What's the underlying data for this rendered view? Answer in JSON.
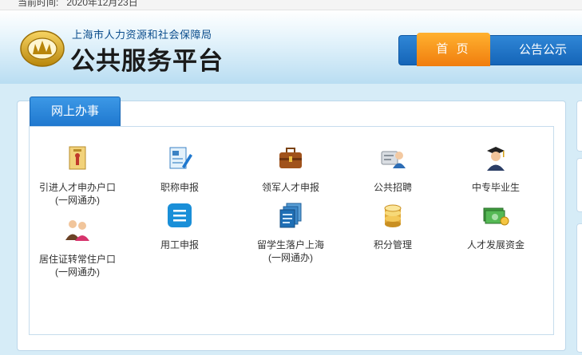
{
  "topbar": {
    "date_text": "当前时间:   2020年12月23日"
  },
  "header": {
    "org_name": "上海市人力资源和社会保障局",
    "platform_name": "公共服务平台",
    "logo_icon": "shanghai-emblem-icon"
  },
  "nav": {
    "home": "首 页",
    "notice": "公告公示"
  },
  "colors": {
    "accent_orange": "#f39214",
    "brand_blue": "#1f78cf",
    "background": "#d6ecf7"
  },
  "panel": {
    "tab_label": "网上办事",
    "services": [
      {
        "label": "引进人才申办户口",
        "sub": "(一网通办)",
        "icon": "document-envelope-icon"
      },
      {
        "label": "职称申报",
        "sub": "",
        "icon": "certificate-pen-icon"
      },
      {
        "label": "领军人才申报",
        "sub": "",
        "icon": "briefcase-icon"
      },
      {
        "label": "公共招聘",
        "sub": "",
        "icon": "recruitment-card-icon"
      },
      {
        "label": "中专毕业生",
        "sub": "",
        "icon": "graduate-icon"
      },
      {
        "label": "居住证转常住户口",
        "sub": "(一网通办)",
        "icon": "people-icon"
      },
      {
        "label": "用工申报",
        "sub": "",
        "icon": "list-icon"
      },
      {
        "label": "留学生落户上海",
        "sub": "(一网通办)",
        "icon": "stacked-documents-icon"
      },
      {
        "label": "积分管理",
        "sub": "",
        "icon": "coin-stack-icon"
      },
      {
        "label": "人才发展资金",
        "sub": "",
        "icon": "money-icon"
      }
    ]
  }
}
